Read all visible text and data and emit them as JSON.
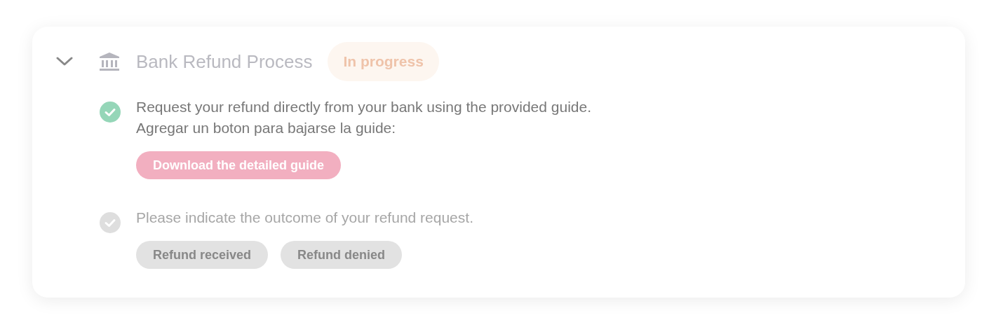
{
  "process": {
    "title": "Bank Refund Process",
    "expanded": true,
    "status": "In progress",
    "steps": [
      {
        "done": true,
        "lines": [
          "Request your refund directly from your bank using the provided guide.",
          "Agregar un boton para bajarse la guide:"
        ],
        "buttons": [
          {
            "label": "Download the detailed guide",
            "disabled": false
          }
        ]
      },
      {
        "done": false,
        "lines": [
          "Please indicate the outcome of your refund request."
        ],
        "buttons": [
          {
            "label": "Refund received",
            "disabled": true
          },
          {
            "label": "Refund denied",
            "disabled": true
          }
        ]
      }
    ]
  }
}
